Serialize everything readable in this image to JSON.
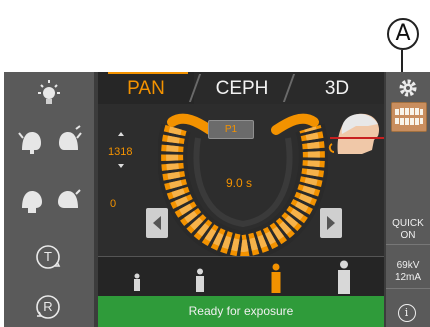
{
  "annotation": {
    "label": "A"
  },
  "tabs": [
    {
      "label": "PAN",
      "active": true
    },
    {
      "label": "CEPH",
      "active": false
    },
    {
      "label": "3D",
      "active": false
    }
  ],
  "settings": {
    "left_value_1": "1318",
    "left_value_2": "0",
    "program": "P1",
    "exposure_time": "9.0 s"
  },
  "right_panel": {
    "quick_line1": "QUICK",
    "quick_line2": "ON",
    "kv": "69kV",
    "ma": "12mA",
    "info_symbol": "i"
  },
  "status": {
    "text": "Ready for exposure"
  },
  "left_icons": [
    "light-bulb-icon",
    "patient-head-left-icon",
    "patient-head-right-icon",
    "patient-head-back-left-icon",
    "patient-head-back-right-icon",
    "t-rotate-icon",
    "r-rotate-icon"
  ],
  "left_icon_letters": {
    "t": "T",
    "r": "R"
  },
  "colors": {
    "accent": "#f39200",
    "status_green": "#2f9b3a",
    "sidebar": "#5a5a5a",
    "panel": "#2d2d2d"
  }
}
